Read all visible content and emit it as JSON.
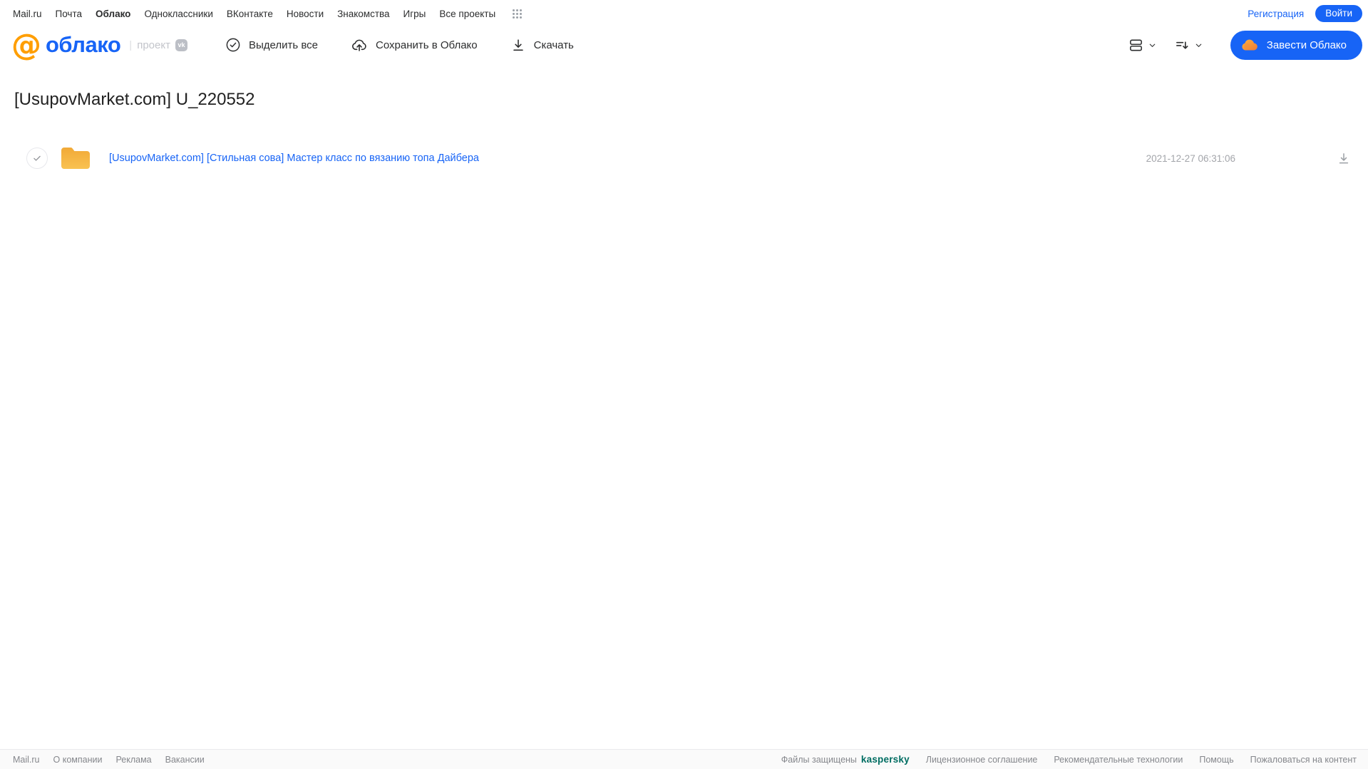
{
  "portal_nav": {
    "links": [
      {
        "label": "Mail.ru"
      },
      {
        "label": "Почта"
      },
      {
        "label": "Облако"
      },
      {
        "label": "Одноклассники"
      },
      {
        "label": "ВКонтакте"
      },
      {
        "label": "Новости"
      },
      {
        "label": "Знакомства"
      },
      {
        "label": "Игры"
      },
      {
        "label": "Все проекты"
      }
    ],
    "registration_label": "Регистрация",
    "login_label": "Войти"
  },
  "header": {
    "logo_at": "@",
    "logo_text": "облако",
    "project_label": "проект",
    "vk_badge": "vk",
    "select_all_label": "Выделить все",
    "save_label": "Сохранить в Облако",
    "download_label": "Скачать",
    "get_cloud_label": "Завести Облако"
  },
  "main": {
    "title": "[UsupovMarket.com] U_220552",
    "files": [
      {
        "type": "folder",
        "name": "[UsupovMarket.com] [Стильная сова] Мастер класс по вязанию топа Дайбера",
        "date": "2021-12-27 06:31:06"
      }
    ]
  },
  "footer": {
    "links_left": [
      {
        "label": "Mail.ru"
      },
      {
        "label": "О компании"
      },
      {
        "label": "Реклама"
      },
      {
        "label": "Вакансии"
      }
    ],
    "protected_text": "Файлы защищены",
    "kaspersky_label": "kaspersky",
    "links_right": [
      {
        "label": "Лицензионное соглашение"
      },
      {
        "label": "Рекомендательные технологии"
      },
      {
        "label": "Помощь"
      },
      {
        "label": "Пожаловаться на контент"
      }
    ]
  },
  "colors": {
    "accent_blue": "#1764f6",
    "logo_orange": "#ff9e00",
    "folder_yellow": "#f6b843",
    "kaspersky_green": "#006d62",
    "text_dark": "#2c2d2e",
    "text_gray": "#85878c"
  }
}
